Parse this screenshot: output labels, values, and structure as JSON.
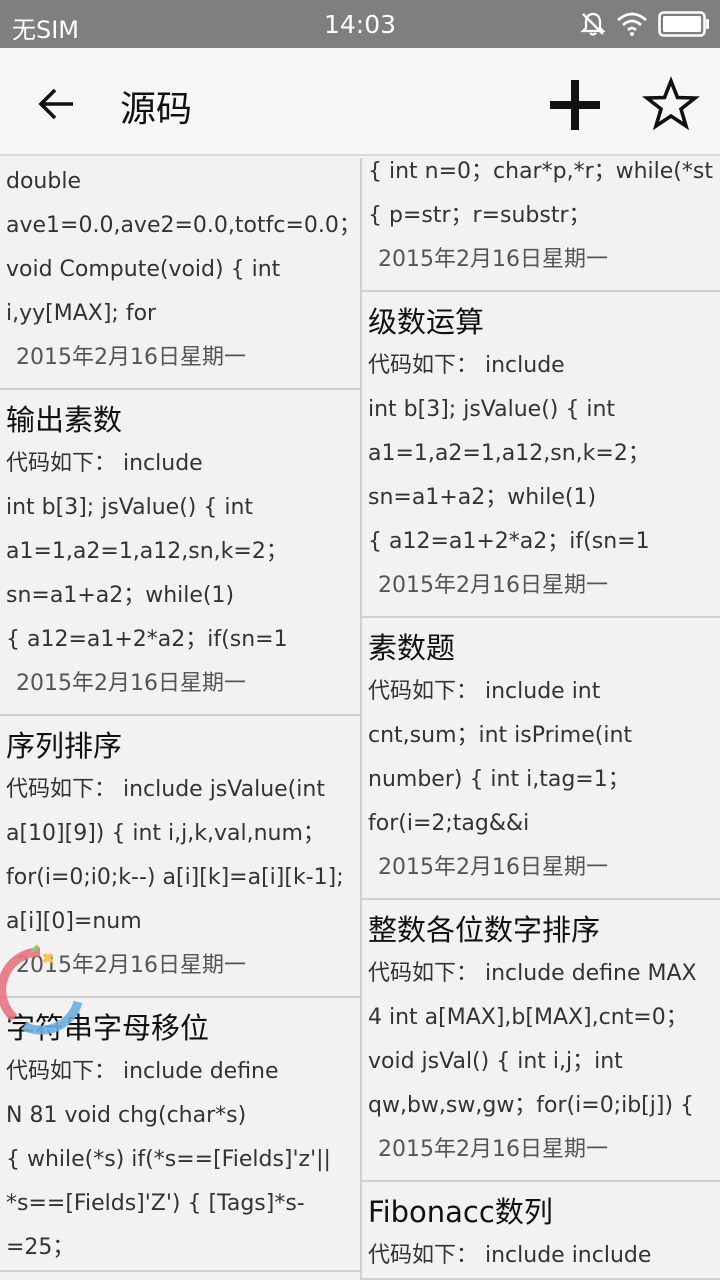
{
  "status_bar": {
    "carrier": "无SIM",
    "time": "14:03",
    "icons": [
      "mute-icon",
      "wifi-icon",
      "battery-icon"
    ]
  },
  "app_bar": {
    "title": "源码",
    "back_icon": "back-arrow-icon",
    "add_icon": "plus-icon",
    "star_icon": "star-icon"
  },
  "left_column": [
    {
      "title": "",
      "lines": [
        "double",
        "ave1=0.0,ave2=0.0,totfc=0.0；",
        "void Compute(void) { int",
        "i,yy[MAX]; for"
      ],
      "date": "2015年2月16日星期一"
    },
    {
      "title": "输出素数",
      "lines": [
        "代码如下：  include",
        "int b[3]; jsValue() { int",
        "a1=1,a2=1,a12,sn,k=2；",
        "sn=a1+a2；while(1)",
        "{ a12=a1+2*a2；if(sn=1"
      ],
      "date": "2015年2月16日星期一"
    },
    {
      "title": "序列排序",
      "lines": [
        "代码如下：  include jsValue(int",
        "a[10][9]) { int i,j,k,val,num；",
        "for(i=0;i0;k--) a[i][k]=a[i][k-1];",
        "a[i][0]=num"
      ],
      "date": "2015年2月16日星期一"
    },
    {
      "title": "字符串字母移位",
      "lines": [
        "代码如下：  include define",
        "N 81 void chg(char*s)",
        "{ while(*s) if(*s==[Fields]'z'||",
        "*s==[Fields]'Z') { [Tags]*s-",
        "=25；"
      ],
      "date": ""
    }
  ],
  "right_column": [
    {
      "title": "",
      "lines": [
        "{ int n=0；char*p,*r；while(*str)",
        "{ p=str；r=substr；"
      ],
      "date": "2015年2月16日星期一"
    },
    {
      "title": "级数运算",
      "lines": [
        "代码如下：  include",
        "int b[3]; jsValue() { int",
        "a1=1,a2=1,a12,sn,k=2；",
        "sn=a1+a2；while(1)",
        "{ a12=a1+2*a2；if(sn=1"
      ],
      "date": "2015年2月16日星期一"
    },
    {
      "title": "素数题",
      "lines": [
        "代码如下：  include int",
        "cnt,sum；int isPrime(int",
        "number) { int i,tag=1；",
        "for(i=2;tag&&i"
      ],
      "date": "2015年2月16日星期一"
    },
    {
      "title": "整数各位数字排序",
      "lines": [
        "代码如下：  include define MAX",
        "4 int a[MAX],b[MAX],cnt=0；",
        "void jsVal() { int i,j；int",
        "qw,bw,sw,gw；for(i=0;ib[j]) {"
      ],
      "date": "2015年2月16日星期一"
    },
    {
      "title": "Fibonacc数列",
      "lines": [
        "代码如下：  include include"
      ],
      "date": ""
    }
  ],
  "colors": {
    "status_bar_bg": "#7f7f7f",
    "app_bar_bg": "#f7f7f7",
    "content_bg": "#f2f2f2",
    "loader_red": "#e8737f",
    "loader_blue": "#6aaee0",
    "loader_yellow": "#f0c84a",
    "loader_green": "#8cc870"
  }
}
